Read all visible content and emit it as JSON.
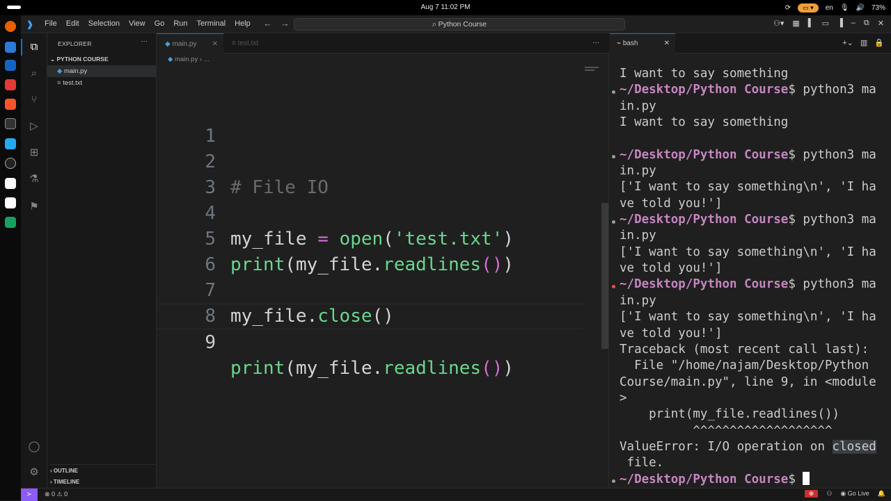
{
  "system": {
    "clock": "Aug 7  11:02 PM",
    "language": "en",
    "battery": "73%"
  },
  "titlebar": {
    "menu": [
      "File",
      "Edit",
      "Selection",
      "View",
      "Go",
      "Run",
      "Terminal",
      "Help"
    ],
    "command_center": "Python Course"
  },
  "sidebar": {
    "header": "EXPLORER",
    "folder": "PYTHON COURSE",
    "files": [
      "main.py",
      "test.txt"
    ],
    "outline": "OUTLINE",
    "timeline": "TIMELINE"
  },
  "editor": {
    "tabs": [
      "main.py",
      "test.txt"
    ],
    "breadcrumb": "main.py › ...",
    "line_numbers": [
      "1",
      "2",
      "3",
      "4",
      "5",
      "6",
      "7",
      "8",
      "9"
    ],
    "code": {
      "l2": "# File IO",
      "l4_var": "my_file",
      "l4_eq": " = ",
      "l4_fn": "open",
      "l4_open": "(",
      "l4_str": "'test.txt'",
      "l4_close": ")",
      "l5_fn": "print",
      "l5_arg": "my_file.",
      "l5_method": "readlines",
      "l7_var": "my_file.",
      "l7_method": "close",
      "l9_fn": "print",
      "l9_arg": "my_file.",
      "l9_method": "readlines"
    }
  },
  "terminal": {
    "tab": "bash",
    "lines": {
      "t1": "I want to say something",
      "t2_prompt": "~/Desktop/Python Course",
      "t2_cmd": " python3 ma",
      "t3": "in.py",
      "t4": "I want to say something",
      "t6_prompt": "~/Desktop/Python Course",
      "t6_cmd": " python3 ma",
      "t7": "in.py",
      "t8": "['I want to say something\\n', 'I ha",
      "t9": "ve told you!']",
      "t10_prompt": "~/Desktop/Python Course",
      "t10_cmd": " python3 ma",
      "t11": "in.py",
      "t12": "['I want to say something\\n', 'I ha",
      "t13": "ve told you!']",
      "t14_prompt": "~/Desktop/Python Course",
      "t14_cmd": " python3 ma",
      "t15": "in.py",
      "t16": "['I want to say something\\n', 'I ha",
      "t17": "ve told you!']",
      "t18": "Traceback (most recent call last):",
      "t19": "  File \"/home/najam/Desktop/Python",
      "t20": "Course/main.py\", line 9, in <module",
      "t21": ">",
      "t22": "    print(my_file.readlines())",
      "t23": "          ^^^^^^^^^^^^^^^^^^^",
      "t24_a": "ValueError: I/O operation on ",
      "t24_b": "closed",
      "t25": " file.",
      "t26_prompt": "~/Desktop/Python Course",
      "dollar": "$"
    }
  },
  "statusbar": {
    "problems": "⊗ 0 ⚠ 0",
    "golive": "Go Live"
  }
}
